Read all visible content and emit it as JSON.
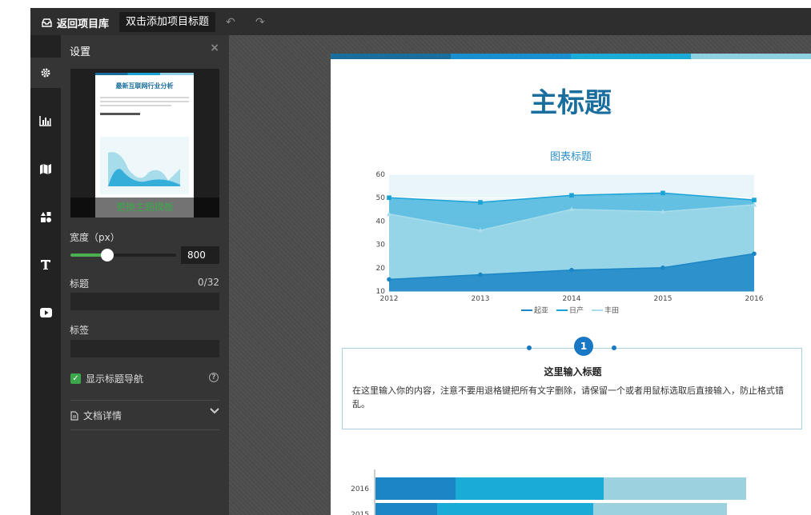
{
  "topbar": {
    "back_label": "返回项目库",
    "title_placeholder": "双击添加项目标题",
    "undo": "↶",
    "redo": "↷"
  },
  "sidebar_icons": [
    "gear-icon",
    "bar-chart-icon",
    "map-icon",
    "shapes-icon",
    "text-icon",
    "video-icon"
  ],
  "panel": {
    "title": "设置",
    "close": "×",
    "thumb": {
      "title": "最新互联网行业分析",
      "overlay": "更换主题模板"
    },
    "width_label": "宽度（px）",
    "width_value": "800",
    "width_fraction": 0.35,
    "title_label": "标题",
    "title_counter": "0/32",
    "tag_label": "标签",
    "show_nav_label": "显示标题导航",
    "show_nav_checked": true,
    "doc_details_label": "文档详情"
  },
  "doc": {
    "strip_colors": [
      "#1a6e9e",
      "#1a8fd0",
      "#1aacd6",
      "#8fd0e0"
    ],
    "main_title": "主标题",
    "card": {
      "number": "1",
      "title": "这里输入标题",
      "body": "在这里输入你的内容，注意不要用退格键把所有文字删除，请保留一个或者用鼠标选取后直接输入，防止格式错乱。"
    }
  },
  "chart_data": [
    {
      "type": "area",
      "title": "图表标题",
      "x": [
        "2012",
        "2013",
        "2014",
        "2015",
        "2016"
      ],
      "ylim": [
        10,
        60
      ],
      "yticks": [
        10,
        20,
        30,
        40,
        50,
        60
      ],
      "series": [
        {
          "name": "起亚",
          "values": [
            15,
            17,
            19,
            20,
            26
          ],
          "color": "#1b86c6"
        },
        {
          "name": "日产",
          "values": [
            50,
            48,
            51,
            52,
            49
          ],
          "color": "#1aa3d6"
        },
        {
          "name": "丰田",
          "values": [
            43,
            36,
            45,
            44,
            47
          ],
          "color": "#a7dcea"
        }
      ],
      "legend": "bottom"
    },
    {
      "type": "bar",
      "orientation": "horizontal-stacked",
      "categories": [
        "2016",
        "2015"
      ],
      "series": [
        {
          "values": [
            100,
            77
          ],
          "color": "#1b86c6"
        },
        {
          "values": [
            185,
            195
          ],
          "color": "#1aacd6"
        },
        {
          "values": [
            178,
            167
          ],
          "color": "#9cd2e0"
        }
      ]
    }
  ]
}
